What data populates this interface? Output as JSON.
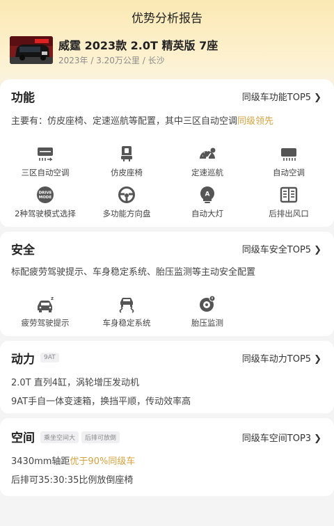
{
  "header": {
    "title": "优势分析报告",
    "car_name": "威霆 2023款 2.0T 精英版 7座",
    "meta": "2023年 / 3.20万公里 / 长沙"
  },
  "sections": {
    "function": {
      "title": "功能",
      "rank": "同级车功能TOP5",
      "desc_prefix": "主要有：仿皮座椅、定速巡航等配置，其中三区自动空调",
      "desc_highlight": "同级领先",
      "features": [
        {
          "label": "三区自动空调",
          "icon": "three-zone-ac-icon"
        },
        {
          "label": "仿皮座椅",
          "icon": "leather-seat-icon"
        },
        {
          "label": "定速巡航",
          "icon": "cruise-control-icon"
        },
        {
          "label": "自动空调",
          "icon": "auto-ac-icon"
        },
        {
          "label": "2种驾驶模式选择",
          "icon": "drive-mode-icon"
        },
        {
          "label": "多功能方向盘",
          "icon": "steering-wheel-icon"
        },
        {
          "label": "自动大灯",
          "icon": "auto-headlight-icon"
        },
        {
          "label": "后排出风口",
          "icon": "rear-vent-icon"
        }
      ]
    },
    "safety": {
      "title": "安全",
      "rank": "同级车安全TOP5",
      "desc": "标配疲劳驾驶提示、车身稳定系统、胎压监测等主动安全配置",
      "features": [
        {
          "label": "疲劳驾驶提示",
          "icon": "fatigue-warning-icon"
        },
        {
          "label": "车身稳定系统",
          "icon": "stability-control-icon"
        },
        {
          "label": "胎压监测",
          "icon": "tire-pressure-icon"
        }
      ]
    },
    "power": {
      "title": "动力",
      "tag": "9AT",
      "rank": "同级车动力TOP5",
      "line1": "2.0T 直列4缸，涡轮增压发动机",
      "line2": "9AT手自一体变速箱，换挡平顺，传动效率高"
    },
    "space": {
      "title": "空间",
      "tag1": "乘坐空间大",
      "tag2": "后排可放倒",
      "rank": "同级车空间TOP3",
      "line1_prefix": "3430mm轴距",
      "line1_highlight": "优于90%同级车",
      "line2": "后排可35:30:35比例放倒座椅"
    }
  },
  "drive_mode_icon_text": [
    "DRIVE",
    "MODE"
  ],
  "colors": {
    "highlight": "#d8a23c",
    "icon": "#555555",
    "hero_top": "#fbe9b4"
  },
  "chevron": "❯"
}
